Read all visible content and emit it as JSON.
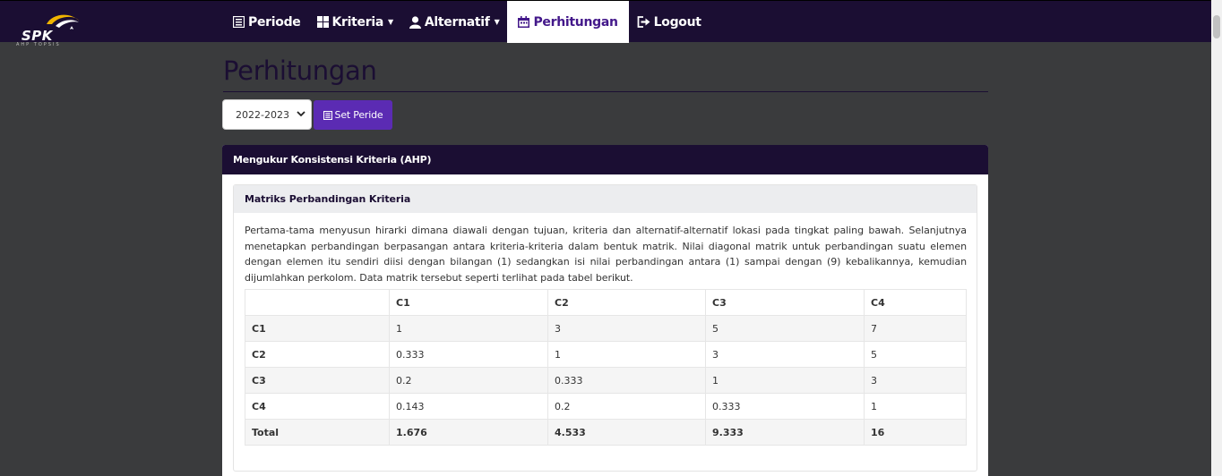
{
  "brand": {
    "name": "SPK",
    "tagline": "AHP TOPSIS"
  },
  "nav": [
    {
      "label": "Periode",
      "icon": "list-icon",
      "dropdown": false,
      "active": false
    },
    {
      "label": "Kriteria",
      "icon": "grid-icon",
      "dropdown": true,
      "active": false
    },
    {
      "label": "Alternatif",
      "icon": "user-icon",
      "dropdown": true,
      "active": false
    },
    {
      "label": "Perhitungan",
      "icon": "calendar-icon",
      "dropdown": false,
      "active": true
    },
    {
      "label": "Logout",
      "icon": "logout-icon",
      "dropdown": false,
      "active": false
    }
  ],
  "page": {
    "title": "Perhitungan"
  },
  "period": {
    "selected": "2022-2023",
    "button_label": "Set Peride"
  },
  "card": {
    "header": "Mengukur Konsistensi Kriteria (AHP)",
    "section_title": "Matriks Perbandingan Kriteria",
    "description": "Pertama-tama menyusun hirarki dimana diawali dengan tujuan, kriteria dan alternatif-alternatif lokasi pada tingkat paling bawah. Selanjutnya menetapkan perbandingan berpasangan antara kriteria-kriteria dalam bentuk matrik. Nilai diagonal matrik untuk perbandingan suatu elemen dengan elemen itu sendiri diisi dengan bilangan (1) sedangkan isi nilai perbandingan antara (1) sampai dengan (9) kebalikannya, kemudian dijumlahkan perkolom. Data matrik tersebut seperti terlihat pada tabel berikut."
  },
  "matrix": {
    "columns": [
      "",
      "C1",
      "C2",
      "C3",
      "C4"
    ],
    "rows": [
      [
        "C1",
        "1",
        "3",
        "5",
        "7"
      ],
      [
        "C2",
        "0.333",
        "1",
        "3",
        "5"
      ],
      [
        "C3",
        "0.2",
        "0.333",
        "1",
        "3"
      ],
      [
        "C4",
        "0.143",
        "0.2",
        "0.333",
        "1"
      ]
    ],
    "total": [
      "Total",
      "1.676",
      "4.533",
      "9.333",
      "16"
    ]
  },
  "colors": {
    "navbar": "#1b0e33",
    "accent": "#5b2bb3",
    "active_text": "#43188a"
  }
}
